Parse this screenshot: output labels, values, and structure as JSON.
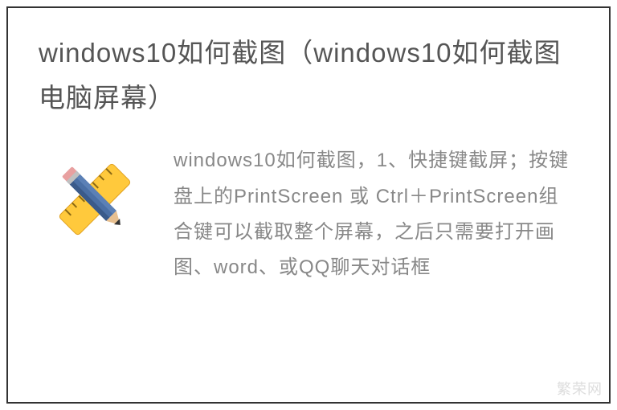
{
  "title": "windows10如何截图（windows10如何截图电脑屏幕）",
  "body": "windows10如何截图，1、快捷键截屏；按键盘上的PrintScreen 或 Ctrl＋PrintScreen组合键可以截取整个屏幕，之后只需要打开画图、word、或QQ聊天对话框",
  "watermark": "繁荣网",
  "icon_name": "ruler-pencil-icon"
}
